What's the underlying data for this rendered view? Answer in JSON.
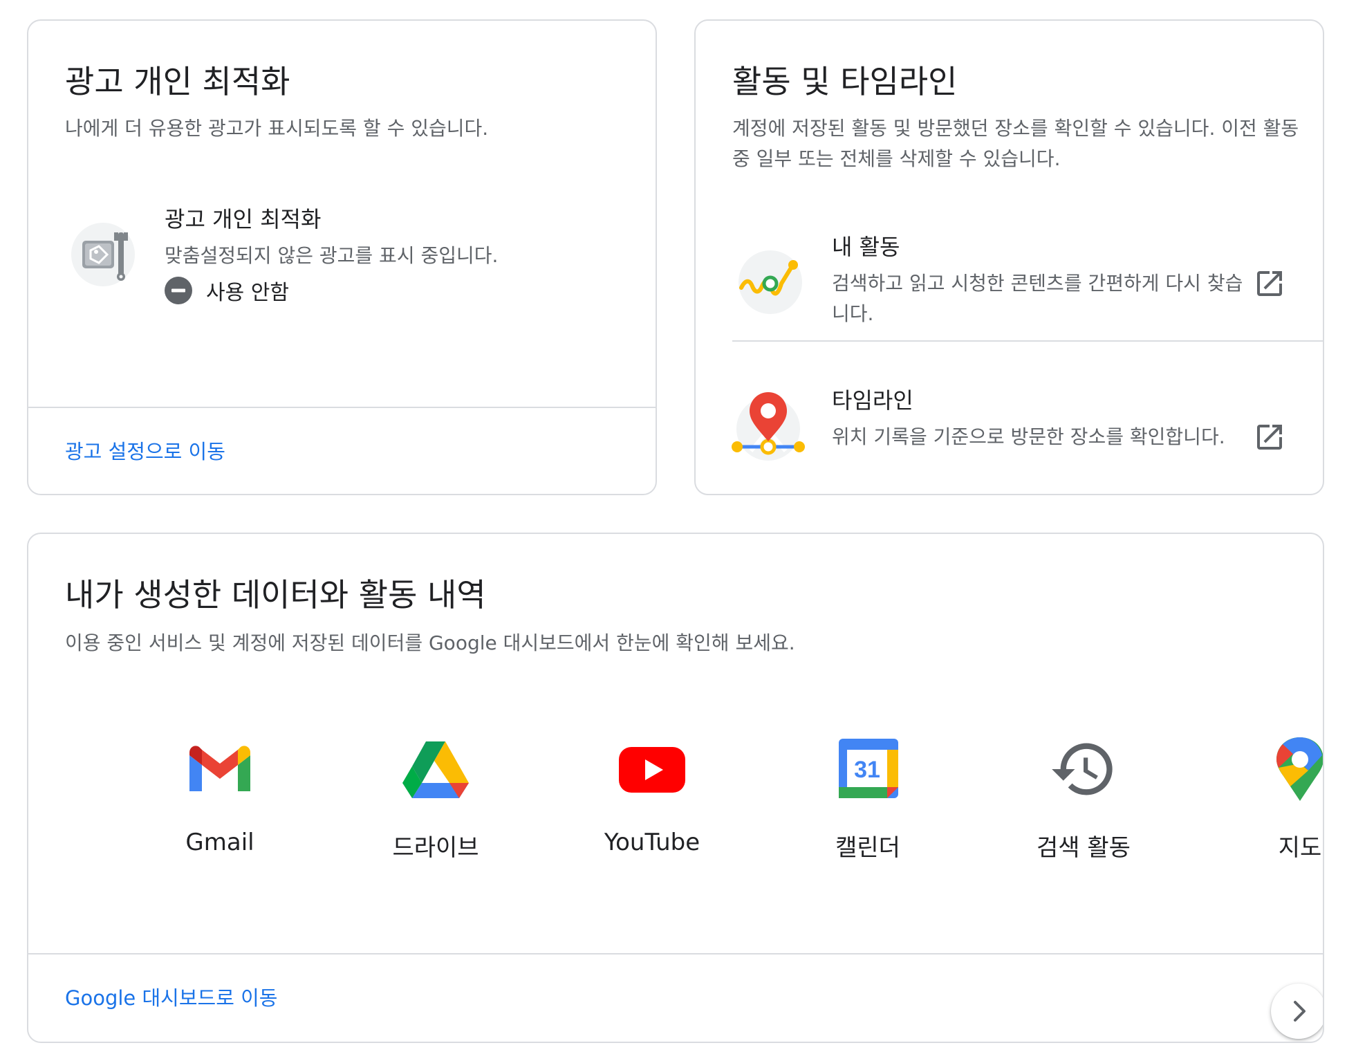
{
  "ads_card": {
    "title": "광고 개인 최적화",
    "description": "나에게 더 유용한 광고가 표시되도록 할 수 있습니다.",
    "setting_title": "광고 개인 최적화",
    "setting_description": "맞춤설정되지 않은 광고를 표시 중입니다.",
    "status_label": "사용 안함",
    "link": "광고 설정으로 이동"
  },
  "activity_card": {
    "title": "활동 및 타임라인",
    "description": "계정에 저장된 활동 및 방문했던 장소를 확인할 수 있습니다. 이전 활동 중 일부 또는 전체를 삭제할 수 있습니다.",
    "items": [
      {
        "title": "내 활동",
        "description": "검색하고 읽고 시청한 콘텐츠를 간편하게 다시 찾습니다."
      },
      {
        "title": "타임라인",
        "description": "위치 기록을 기준으로 방문한 장소를 확인합니다."
      }
    ]
  },
  "data_card": {
    "title": "내가 생성한 데이터와 활동 내역",
    "description": "이용 중인 서비스 및 계정에 저장된 데이터를 Google 대시보드에서 한눈에 확인해 보세요.",
    "services": [
      {
        "label": "Gmail",
        "icon": "gmail-icon"
      },
      {
        "label": "드라이브",
        "icon": "drive-icon"
      },
      {
        "label": "YouTube",
        "icon": "youtube-icon"
      },
      {
        "label": "캘린더",
        "icon": "calendar-icon",
        "icon_text": "31"
      },
      {
        "label": "검색 활동",
        "icon": "history-icon"
      },
      {
        "label": "지도",
        "icon": "maps-icon"
      }
    ],
    "link": "Google 대시보드로 이동"
  },
  "colors": {
    "link": "#1a73e8",
    "border": "#dadce0",
    "text_secondary": "#5f6368",
    "google_blue": "#4285f4",
    "google_red": "#ea4335",
    "google_yellow": "#fbbc04",
    "google_green": "#34a853"
  }
}
